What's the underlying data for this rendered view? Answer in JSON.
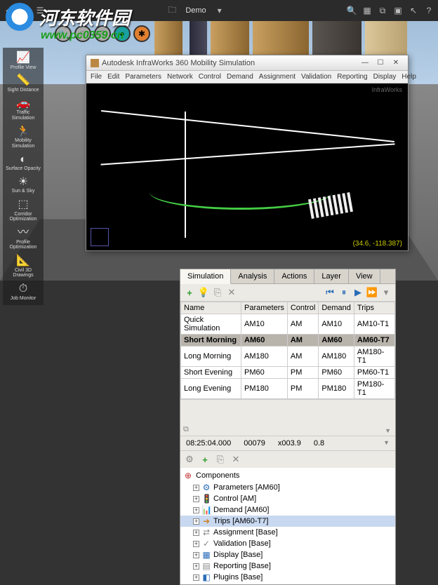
{
  "watermark": {
    "text": "河东软件园",
    "url": "www.pc0359.cn"
  },
  "topbar": {
    "project_label": "Demo"
  },
  "left_palette": [
    {
      "label": "Profile View"
    },
    {
      "label": "Sight Distance"
    },
    {
      "label": "Traffic Simulation"
    },
    {
      "label": "Mobility Simulation"
    },
    {
      "label": "Surface Opacity"
    },
    {
      "label": "Sun & Sky"
    },
    {
      "label": "Corridor Optimization"
    },
    {
      "label": "Profile Optimization"
    },
    {
      "label": "Civil 3D Drawings"
    },
    {
      "label": "Job Monitor"
    }
  ],
  "inner_window": {
    "title": "Autodesk InfraWorks 360 Mobility Simulation",
    "menus": [
      "File",
      "Edit",
      "Parameters",
      "Network",
      "Control",
      "Demand",
      "Assignment",
      "Validation",
      "Reporting",
      "Display",
      "Help"
    ],
    "brand": "InfraWorks",
    "coords": "(34.6, -118.387)"
  },
  "sim_panel": {
    "tabs": [
      "Simulation",
      "Analysis",
      "Actions",
      "Layer",
      "View"
    ],
    "active_tab": 0,
    "columns": [
      "Name",
      "Parameters",
      "Control",
      "Demand",
      "Trips"
    ],
    "rows": [
      {
        "cells": [
          "Quick Simulation",
          "AM10",
          "AM",
          "AM10",
          "AM10-T1"
        ],
        "selected": false
      },
      {
        "cells": [
          "Short Morning",
          "AM60",
          "AM",
          "AM60",
          "AM60-T7"
        ],
        "selected": true
      },
      {
        "cells": [
          "Long Morning",
          "AM180",
          "AM",
          "AM180",
          "AM180-T1"
        ],
        "selected": false
      },
      {
        "cells": [
          "Short Evening",
          "PM60",
          "PM",
          "PM60",
          "PM60-T1"
        ],
        "selected": false
      },
      {
        "cells": [
          "Long Evening",
          "PM180",
          "PM",
          "PM180",
          "PM180-T1"
        ],
        "selected": false
      }
    ],
    "time": {
      "clock": "08:25:04.000",
      "step": "00079",
      "speed": "x003.9",
      "factor": "0.8"
    },
    "tree_root": "Components",
    "tree": [
      {
        "label": "Parameters [AM60]",
        "icon": "⚙",
        "color": "#2a6db8"
      },
      {
        "label": "Control [AM]",
        "icon": "🚦",
        "color": "#2a9d2a"
      },
      {
        "label": "Demand [AM60]",
        "icon": "📊",
        "color": "#b86b2a"
      },
      {
        "label": "Trips [AM60-T7]",
        "icon": "➜",
        "color": "#d08020",
        "selected": true
      },
      {
        "label": "Assignment [Base]",
        "icon": "⇄",
        "color": "#888"
      },
      {
        "label": "Validation [Base]",
        "icon": "✓",
        "color": "#888"
      },
      {
        "label": "Display [Base]",
        "icon": "▦",
        "color": "#2a6db8"
      },
      {
        "label": "Reporting [Base]",
        "icon": "▤",
        "color": "#888"
      },
      {
        "label": "Plugins [Base]",
        "icon": "◧",
        "color": "#2a6db8"
      }
    ]
  }
}
